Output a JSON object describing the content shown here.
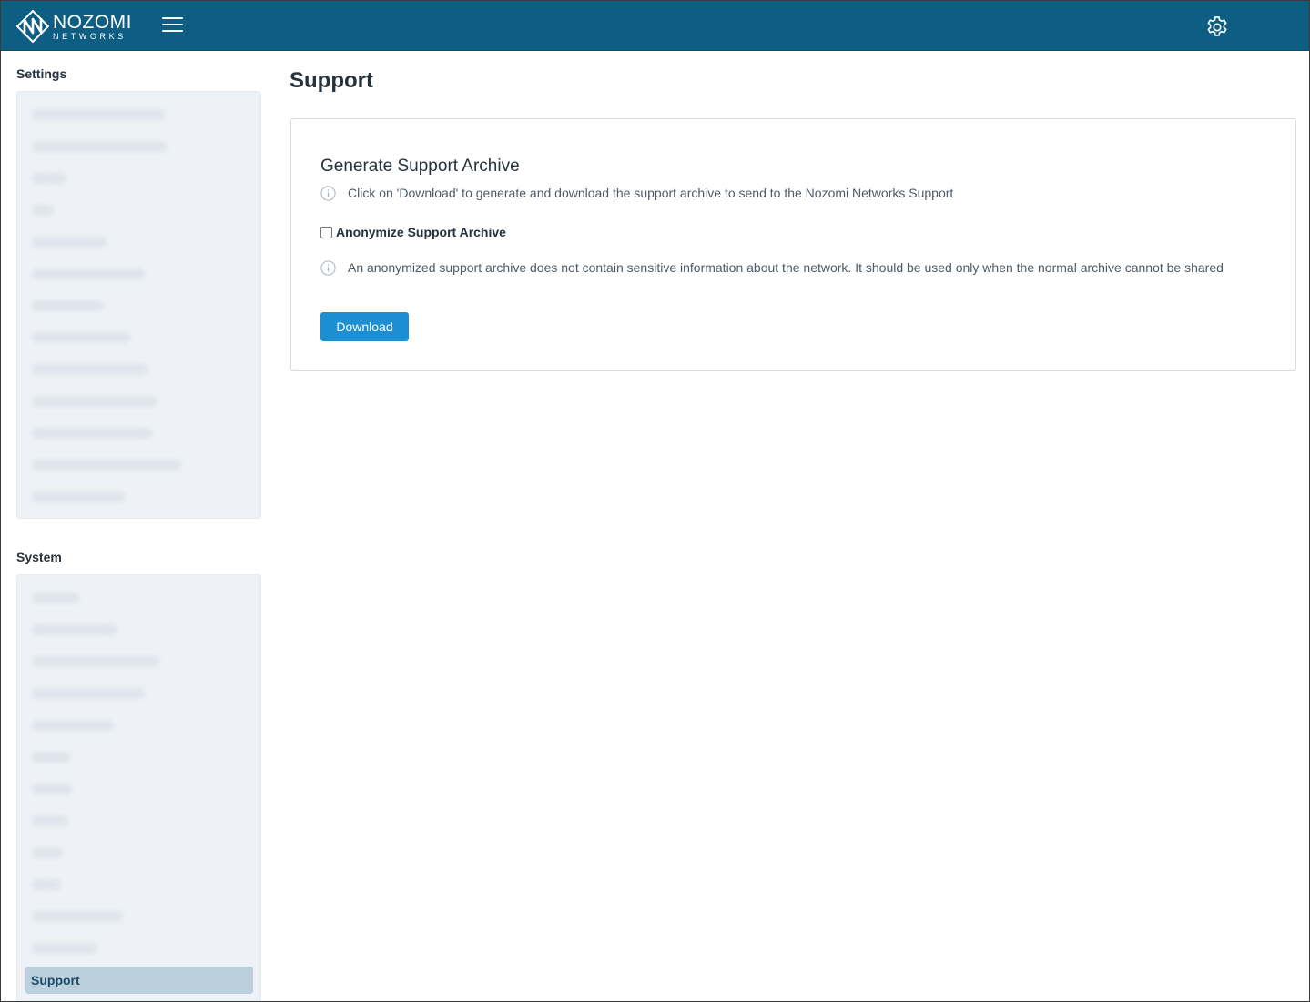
{
  "header": {
    "brand": "NOZOMI",
    "brand_sub": "NETWORKS",
    "menu_icon": "hamburger-menu-icon",
    "settings_icon": "gear-icon",
    "background_color": "#0e5d82"
  },
  "sidebar": {
    "settings_title": "Settings",
    "settings_items_redacted": 13,
    "system_title": "System",
    "system_items_redacted": 12,
    "active_item": "Support",
    "active_color": "#bccfdc"
  },
  "main": {
    "title": "Support",
    "card": {
      "title": "Generate Support Archive",
      "info_download": "Click on 'Download' to generate and download the support archive to send to the Nozomi Networks Support",
      "anonymize_label": "Anonymize Support Archive",
      "anonymize_checked": false,
      "info_anonymize": "An anonymized support archive does not contain sensitive information about the network. It should be used only when the normal archive cannot be shared",
      "download_label": "Download",
      "button_color": "#1b8fd2"
    }
  }
}
